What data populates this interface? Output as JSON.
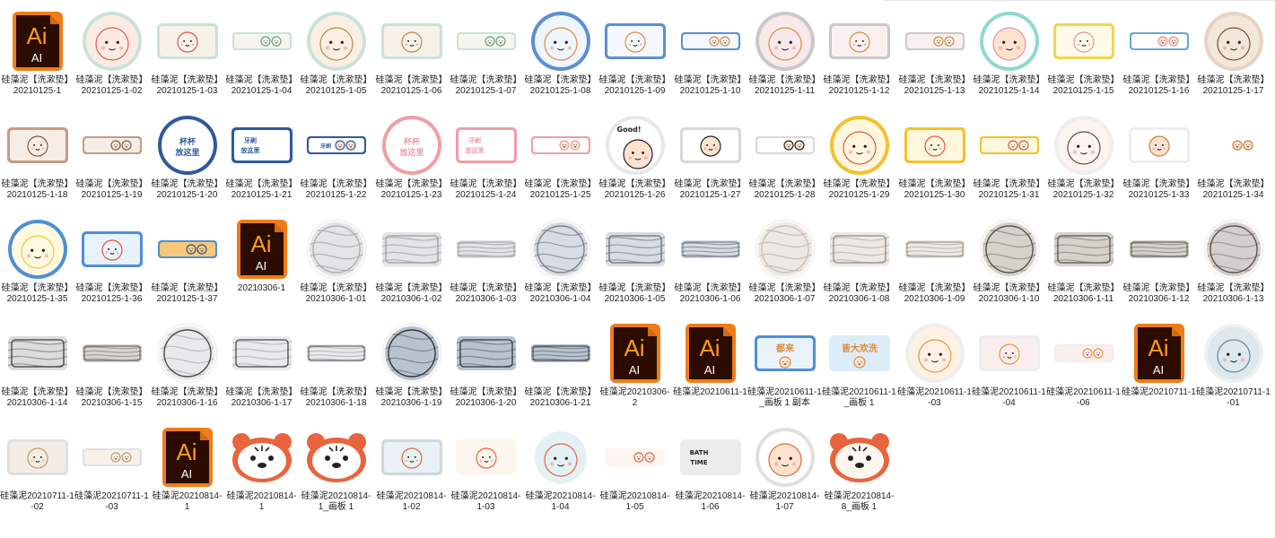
{
  "files": [
    {
      "name": "硅藻泥【洗漱垫】20210125-1",
      "thumb": {
        "kind": "ai"
      }
    },
    {
      "name": "硅藻泥【洗漱垫】20210125-1-02",
      "thumb": {
        "kind": "circle",
        "bg": "#fdebe3",
        "ring": "#c9e3d8",
        "fg": "#d65a57"
      }
    },
    {
      "name": "硅藻泥【洗漱垫】20210125-1-03",
      "thumb": {
        "kind": "rect",
        "bg": "#f7f1e8",
        "ring": "#c9e3d8",
        "fg": "#d65a57"
      }
    },
    {
      "name": "硅藻泥【洗漱垫】20210125-1-04",
      "thumb": {
        "kind": "slim",
        "bg": "#f7f4ee",
        "ring": "#c9e3d8",
        "fg": "#6aa07d"
      }
    },
    {
      "name": "硅藻泥【洗漱垫】20210125-1-05",
      "thumb": {
        "kind": "circle",
        "bg": "#fbeee3",
        "ring": "#c9e3d8",
        "fg": "#b58a52"
      }
    },
    {
      "name": "硅藻泥【洗漱垫】20210125-1-06",
      "thumb": {
        "kind": "rect",
        "bg": "#f7f1e8",
        "ring": "#c9e3d8",
        "fg": "#b58a52"
      }
    },
    {
      "name": "硅藻泥【洗漱垫】20210125-1-07",
      "thumb": {
        "kind": "slim",
        "bg": "#f7f4ee",
        "ring": "#c9e3d8",
        "fg": "#6aa07d"
      }
    },
    {
      "name": "硅藻泥【洗漱垫】20210125-1-08",
      "thumb": {
        "kind": "circle",
        "bg": "#eef5fb",
        "ring": "#5c8fd0",
        "fg": "#e08a3c"
      }
    },
    {
      "name": "硅藻泥【洗漱垫】20210125-1-09",
      "thumb": {
        "kind": "rect",
        "bg": "#f4f8fc",
        "ring": "#5c8fd0",
        "fg": "#e08a3c"
      }
    },
    {
      "name": "硅藻泥【洗漱垫】20210125-1-10",
      "thumb": {
        "kind": "slim",
        "bg": "#f4f8fc",
        "ring": "#5c8fd0",
        "fg": "#e08a3c"
      }
    },
    {
      "name": "硅藻泥【洗漱垫】20210125-1-11",
      "thumb": {
        "kind": "circle",
        "bg": "#f8e9ea",
        "ring": "#c9c9c9",
        "fg": "#e08a3c"
      }
    },
    {
      "name": "硅藻泥【洗漱垫】20210125-1-12",
      "thumb": {
        "kind": "rect",
        "bg": "#fbf0f0",
        "ring": "#c9c9c9",
        "fg": "#e08a3c"
      }
    },
    {
      "name": "硅藻泥【洗漱垫】20210125-1-13",
      "thumb": {
        "kind": "slim",
        "bg": "#fbf0f0",
        "ring": "#c9c9c9",
        "fg": "#e08a3c"
      }
    },
    {
      "name": "硅藻泥【洗漱垫】20210125-1-14",
      "thumb": {
        "kind": "circle",
        "bg": "#ffffff",
        "ring": "#8fd8cf",
        "fg": "#e891a8"
      }
    },
    {
      "name": "硅藻泥【洗漱垫】20210125-1-15",
      "thumb": {
        "kind": "rect",
        "bg": "#fffbe8",
        "ring": "#f2d64b",
        "fg": "#e891a8"
      }
    },
    {
      "name": "硅藻泥【洗漱垫】20210125-1-16",
      "thumb": {
        "kind": "slim",
        "bg": "#ffffff",
        "ring": "#6aa6d8",
        "fg": "#e891a8"
      }
    },
    {
      "name": "硅藻泥【洗漱垫】20210125-1-17",
      "thumb": {
        "kind": "circle",
        "bg": "#f3e6db",
        "ring": "#e6d3c3",
        "fg": "#7a5236"
      }
    },
    {
      "name": "硅藻泥【洗漱垫】20210125-1-18",
      "thumb": {
        "kind": "rect",
        "bg": "#f6ede6",
        "ring": "#c59c86",
        "fg": "#8a5a3c"
      }
    },
    {
      "name": "硅藻泥【洗漱垫】20210125-1-19",
      "thumb": {
        "kind": "slim",
        "bg": "#f6ede6",
        "ring": "#c59c86",
        "fg": "#8a5a3c"
      }
    },
    {
      "name": "硅藻泥【洗漱垫】20210125-1-20",
      "thumb": {
        "kind": "circle",
        "bg": "#ffffff",
        "ring": "#2e5a9b",
        "fg": "#2e5a9b",
        "text": "杯杯 放这里"
      }
    },
    {
      "name": "硅藻泥【洗漱垫】20210125-1-21",
      "thumb": {
        "kind": "rect",
        "bg": "#ffffff",
        "ring": "#2e5a9b",
        "fg": "#2e5a9b",
        "text": "牙刷 放这里"
      }
    },
    {
      "name": "硅藻泥【洗漱垫】20210125-1-22",
      "thumb": {
        "kind": "slim",
        "bg": "#ffffff",
        "ring": "#2e5a9b",
        "fg": "#2e5a9b",
        "text": "牙刷 放这里"
      }
    },
    {
      "name": "硅藻泥【洗漱垫】20210125-1-23",
      "thumb": {
        "kind": "circle",
        "bg": "#ffffff",
        "ring": "#ef9ea5",
        "fg": "#ef9ea5",
        "text": "杯杯 放这里"
      }
    },
    {
      "name": "硅藻泥【洗漱垫】20210125-1-24",
      "thumb": {
        "kind": "rect",
        "bg": "#ffffff",
        "ring": "#ef9ea5",
        "fg": "#ef9ea5",
        "text": "牙刷 放这里"
      }
    },
    {
      "name": "硅藻泥【洗漱垫】20210125-1-25",
      "thumb": {
        "kind": "slim",
        "bg": "#ffffff",
        "ring": "#ef9ea5",
        "fg": "#ef9ea5"
      }
    },
    {
      "name": "硅藻泥【洗漱垫】20210125-1-26",
      "thumb": {
        "kind": "circle",
        "bg": "#ffffff",
        "ring": "#e8e8e8",
        "fg": "#222222",
        "text": "Good!"
      }
    },
    {
      "name": "硅藻泥【洗漱垫】20210125-1-27",
      "thumb": {
        "kind": "rect",
        "bg": "#ffffff",
        "ring": "#d8d8d8",
        "fg": "#222222"
      }
    },
    {
      "name": "硅藻泥【洗漱垫】20210125-1-28",
      "thumb": {
        "kind": "slim",
        "bg": "#ffffff",
        "ring": "#d8d8d8",
        "fg": "#222222"
      }
    },
    {
      "name": "硅藻泥【洗漱垫】20210125-1-29",
      "thumb": {
        "kind": "circle",
        "bg": "#fff7dd",
        "ring": "#f2c12e",
        "fg": "#e2563f"
      }
    },
    {
      "name": "硅藻泥【洗漱垫】20210125-1-30",
      "thumb": {
        "kind": "rect",
        "bg": "#fff7dd",
        "ring": "#f2c12e",
        "fg": "#e2563f"
      }
    },
    {
      "name": "硅藻泥【洗漱垫】20210125-1-31",
      "thumb": {
        "kind": "slim",
        "bg": "#fff7dd",
        "ring": "#f2c12e",
        "fg": "#e2563f"
      }
    },
    {
      "name": "硅藻泥【洗漱垫】20210125-1-32",
      "thumb": {
        "kind": "circle",
        "bg": "#fdf3ef",
        "ring": "#eeeeee",
        "fg": "#555555"
      }
    },
    {
      "name": "硅藻泥【洗漱垫】20210125-1-33",
      "thumb": {
        "kind": "rect",
        "bg": "#ffffff",
        "ring": "#eeeeee",
        "fg": "#c6833b"
      }
    },
    {
      "name": "硅藻泥【洗漱垫】20210125-1-34",
      "thumb": {
        "kind": "slim",
        "bg": "#ffffff",
        "ring": "#ffffff",
        "fg": "#c6833b"
      }
    },
    {
      "name": "硅藻泥【洗漱垫】20210125-1-35",
      "thumb": {
        "kind": "circle",
        "bg": "#fff9e0",
        "ring": "#4f8fd6",
        "fg": "#f0c43a"
      }
    },
    {
      "name": "硅藻泥【洗漱垫】20210125-1-36",
      "thumb": {
        "kind": "rect",
        "bg": "#e8f2fb",
        "ring": "#4f8fd6",
        "fg": "#e2563f"
      }
    },
    {
      "name": "硅藻泥【洗漱垫】20210125-1-37",
      "thumb": {
        "kind": "slim",
        "bg": "#f7c77a",
        "ring": "#4f8fd6",
        "fg": "#2e5a9b"
      }
    },
    {
      "name": "20210306-1",
      "thumb": {
        "kind": "ai"
      }
    },
    {
      "name": "硅藻泥【洗漱垫】20210306-1-01",
      "thumb": {
        "kind": "marble-circle",
        "bg": "#e4e3e6",
        "ring": "#b0aeb4",
        "fg": "#8e8b96"
      }
    },
    {
      "name": "硅藻泥【洗漱垫】20210306-1-02",
      "thumb": {
        "kind": "marble-rect",
        "bg": "#e4e3e6",
        "ring": "#9f9da4",
        "fg": "#8e8b96"
      }
    },
    {
      "name": "硅藻泥【洗漱垫】20210306-1-03",
      "thumb": {
        "kind": "marble-slim",
        "bg": "#e4e3e6",
        "ring": "#9f9da4",
        "fg": "#8e8b96"
      }
    },
    {
      "name": "硅藻泥【洗漱垫】20210306-1-04",
      "thumb": {
        "kind": "marble-circle",
        "bg": "#d7dbe2",
        "ring": "#7b7f88",
        "fg": "#5d6776"
      }
    },
    {
      "name": "硅藻泥【洗漱垫】20210306-1-05",
      "thumb": {
        "kind": "marble-rect",
        "bg": "#d7dbe2",
        "ring": "#6b6f78",
        "fg": "#5d6776"
      }
    },
    {
      "name": "硅藻泥【洗漱垫】20210306-1-06",
      "thumb": {
        "kind": "marble-slim",
        "bg": "#d7dbe2",
        "ring": "#6b6f78",
        "fg": "#5d6776"
      }
    },
    {
      "name": "硅藻泥【洗漱垫】20210306-1-07",
      "thumb": {
        "kind": "marble-circle",
        "bg": "#ece8e3",
        "ring": "#c8c2ba",
        "fg": "#a49c92"
      }
    },
    {
      "name": "硅藻泥【洗漱垫】20210306-1-08",
      "thumb": {
        "kind": "marble-rect",
        "bg": "#ece8e3",
        "ring": "#8f8a84",
        "fg": "#a49c92"
      }
    },
    {
      "name": "硅藻泥【洗漱垫】20210306-1-09",
      "thumb": {
        "kind": "marble-slim",
        "bg": "#ece8e3",
        "ring": "#8f8a84",
        "fg": "#a49c92"
      }
    },
    {
      "name": "硅藻泥【洗漱垫】20210306-1-10",
      "thumb": {
        "kind": "marble-circle",
        "bg": "#d5d2cc",
        "ring": "#55524e",
        "fg": "#6f6a62"
      }
    },
    {
      "name": "硅藻泥【洗漱垫】20210306-1-11",
      "thumb": {
        "kind": "marble-rect",
        "bg": "#d5d2cc",
        "ring": "#55524e",
        "fg": "#6f6a62"
      }
    },
    {
      "name": "硅藻泥【洗漱垫】20210306-1-12",
      "thumb": {
        "kind": "marble-slim",
        "bg": "#d5d2cc",
        "ring": "#55524e",
        "fg": "#6f6a62"
      }
    },
    {
      "name": "硅藻泥【洗漱垫】20210306-1-13",
      "thumb": {
        "kind": "marble-circle",
        "bg": "#d3cfcc",
        "ring": "#5a5654",
        "fg": "#7b6f6c"
      }
    },
    {
      "name": "硅藻泥【洗漱垫】20210306-1-14",
      "thumb": {
        "kind": "marble-rect",
        "bg": "#dcdcdc",
        "ring": "#3e3e3e",
        "fg": "#5e5e5e"
      }
    },
    {
      "name": "硅藻泥【洗漱垫】20210306-1-15",
      "thumb": {
        "kind": "marble-slim",
        "bg": "#d9d4d0",
        "ring": "#5a5654",
        "fg": "#7b6f6c"
      }
    },
    {
      "name": "硅藻泥【洗漱垫】20210306-1-16",
      "thumb": {
        "kind": "marble-circle",
        "bg": "#e9e8ea",
        "ring": "#4a4a4e",
        "fg": "#9a98a0"
      }
    },
    {
      "name": "硅藻泥【洗漱垫】20210306-1-17",
      "thumb": {
        "kind": "marble-rect",
        "bg": "#e9e8ea",
        "ring": "#4a4a4e",
        "fg": "#9a98a0"
      }
    },
    {
      "name": "硅藻泥【洗漱垫】20210306-1-18",
      "thumb": {
        "kind": "marble-slim",
        "bg": "#e9e8ea",
        "ring": "#4a4a4e",
        "fg": "#9a98a0"
      }
    },
    {
      "name": "硅藻泥【洗漱垫】20210306-1-19",
      "thumb": {
        "kind": "marble-circle",
        "bg": "#b9c3cf",
        "ring": "#33363c",
        "fg": "#4c5a6c"
      }
    },
    {
      "name": "硅藻泥【洗漱垫】20210306-1-20",
      "thumb": {
        "kind": "marble-rect",
        "bg": "#b9c3cf",
        "ring": "#33363c",
        "fg": "#4c5a6c"
      }
    },
    {
      "name": "硅藻泥【洗漱垫】20210306-1-21",
      "thumb": {
        "kind": "marble-slim",
        "bg": "#b9c3cf",
        "ring": "#33363c",
        "fg": "#4c5a6c"
      }
    },
    {
      "name": "硅藻泥20210306-2",
      "thumb": {
        "kind": "ai"
      }
    },
    {
      "name": "硅藻泥20210611-1",
      "thumb": {
        "kind": "ai"
      }
    },
    {
      "name": "硅藻泥20210611-1_画板 1 副本",
      "thumb": {
        "kind": "rect",
        "bg": "#eaf3fb",
        "ring": "#4f8fd6",
        "fg": "#e08a3c",
        "text": "都来"
      }
    },
    {
      "name": "硅藻泥20210611-1_画板 1",
      "thumb": {
        "kind": "rect",
        "bg": "#dcecf8",
        "ring": "#dcecf8",
        "fg": "#e08a3c",
        "text": "皆大欢洗"
      }
    },
    {
      "name": "硅藻泥20210611-1-03",
      "thumb": {
        "kind": "circle",
        "bg": "#fdf1e4",
        "ring": "#eeeeee",
        "fg": "#e89a3c"
      }
    },
    {
      "name": "硅藻泥20210611-1-04",
      "thumb": {
        "kind": "rect",
        "bg": "#fbeeee",
        "ring": "#eeeeee",
        "fg": "#e89a3c"
      }
    },
    {
      "name": "硅藻泥20210611-1-06",
      "thumb": {
        "kind": "slim",
        "bg": "#fbeeee",
        "ring": "#eeeeee",
        "fg": "#e89a3c"
      }
    },
    {
      "name": "硅藻泥20210711-1",
      "thumb": {
        "kind": "ai"
      }
    },
    {
      "name": "硅藻泥20210711-1-01",
      "thumb": {
        "kind": "circle",
        "bg": "#dce8ee",
        "ring": "#f0f0f0",
        "fg": "#6e8596"
      }
    },
    {
      "name": "硅藻泥20210711-1-02",
      "thumb": {
        "kind": "rect",
        "bg": "#f3ede6",
        "ring": "#e0e0e0",
        "fg": "#c99a62"
      }
    },
    {
      "name": "硅藻泥20210711-1-03",
      "thumb": {
        "kind": "slim",
        "bg": "#f7f1ea",
        "ring": "#e0e0e0",
        "fg": "#c99a62"
      }
    },
    {
      "name": "硅藻泥20210814-1",
      "thumb": {
        "kind": "ai"
      }
    },
    {
      "name": "硅藻泥20210814-1",
      "thumb": {
        "kind": "tiger",
        "bg": "#ffffff",
        "ring": "#e8643c",
        "fg": "#222222"
      }
    },
    {
      "name": "硅藻泥20210814-1_画板 1",
      "thumb": {
        "kind": "tiger",
        "bg": "#ffffff",
        "ring": "#e8643c",
        "fg": "#222222"
      }
    },
    {
      "name": "硅藻泥20210814-1-02",
      "thumb": {
        "kind": "rect",
        "bg": "#e8f1f5",
        "ring": "#cfd8dc",
        "fg": "#e8643c"
      }
    },
    {
      "name": "硅藻泥20210814-1-03",
      "thumb": {
        "kind": "rect",
        "bg": "#fdf6ee",
        "ring": "#fdf6ee",
        "fg": "#e8643c"
      }
    },
    {
      "name": "硅藻泥20210814-1-04",
      "thumb": {
        "kind": "circle",
        "bg": "#e3f0f4",
        "ring": "#ffffff",
        "fg": "#e8643c"
      }
    },
    {
      "name": "硅藻泥20210814-1-05",
      "thumb": {
        "kind": "slim",
        "bg": "#fdf6ee",
        "ring": "#fdf6ee",
        "fg": "#e8643c"
      }
    },
    {
      "name": "硅藻泥20210814-1-06",
      "thumb": {
        "kind": "rect",
        "bg": "#ececec",
        "ring": "#ececec",
        "fg": "#222222",
        "text": "BATH TIME"
      }
    },
    {
      "name": "硅藻泥20210814-1-07",
      "thumb": {
        "kind": "circle",
        "bg": "#ffffff",
        "ring": "#e0e0e0",
        "fg": "#e8643c"
      }
    },
    {
      "name": "硅藻泥20210814-8_画板 1",
      "thumb": {
        "kind": "tiger",
        "bg": "#fdf6ee",
        "ring": "#e8643c",
        "fg": "#222222"
      }
    }
  ]
}
